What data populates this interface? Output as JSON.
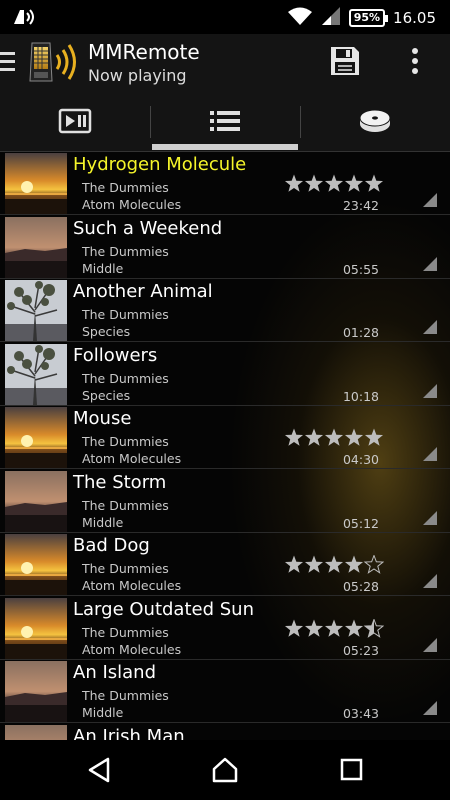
{
  "status_bar": {
    "battery": "95%",
    "time": "16.05",
    "icons": [
      "notification-icon",
      "wifi-icon",
      "signal-icon",
      "battery-icon"
    ]
  },
  "action_bar": {
    "title": "MMRemote",
    "subtitle": "Now playing",
    "icons": [
      "menu-icon",
      "app-logo",
      "save-icon",
      "overflow-icon"
    ]
  },
  "tabs": [
    {
      "icon": "playback-tab-icon",
      "selected": false
    },
    {
      "icon": "list-tab-icon",
      "selected": true
    },
    {
      "icon": "disc-tab-icon",
      "selected": false
    }
  ],
  "colors": {
    "accent_playing": "#f5f52a",
    "star": "#bdbdbd",
    "background": "#050505"
  },
  "tracks": [
    {
      "title": "Hydrogen Molecule",
      "artist": "The Dummies",
      "album": "Atom Molecules",
      "duration": "23:42",
      "rating": 5,
      "thumb": "sunset",
      "playing": true
    },
    {
      "title": "Such a Weekend",
      "artist": "The Dummies",
      "album": "Middle",
      "duration": "05:55",
      "rating": 0,
      "thumb": "dusk",
      "playing": false
    },
    {
      "title": "Another Animal",
      "artist": "The Dummies",
      "album": "Species",
      "duration": "01:28",
      "rating": 0,
      "thumb": "tree",
      "playing": false
    },
    {
      "title": "Followers",
      "artist": "The Dummies",
      "album": "Species",
      "duration": "10:18",
      "rating": 0,
      "thumb": "tree",
      "playing": false
    },
    {
      "title": "Mouse",
      "artist": "The Dummies",
      "album": "Atom Molecules",
      "duration": "04:30",
      "rating": 5,
      "thumb": "sunset",
      "playing": false
    },
    {
      "title": "The Storm",
      "artist": "The Dummies",
      "album": "Middle",
      "duration": "05:12",
      "rating": 0,
      "thumb": "dusk",
      "playing": false
    },
    {
      "title": "Bad Dog",
      "artist": "The Dummies",
      "album": "Atom Molecules",
      "duration": "05:28",
      "rating": 4,
      "thumb": "sunset",
      "playing": false
    },
    {
      "title": "Large Outdated Sun",
      "artist": "The Dummies",
      "album": "Atom Molecules",
      "duration": "05:23",
      "rating": 4.5,
      "thumb": "sunset",
      "playing": false
    },
    {
      "title": "An Island",
      "artist": "The Dummies",
      "album": "Middle",
      "duration": "03:43",
      "rating": 0,
      "thumb": "dusk",
      "playing": false
    },
    {
      "title": "An Irish Man",
      "artist": "",
      "album": "",
      "duration": "",
      "rating": 0,
      "thumb": "dusk",
      "playing": false
    }
  ],
  "nav_bar": {
    "icons": [
      "back-icon",
      "home-icon",
      "recents-icon"
    ]
  }
}
